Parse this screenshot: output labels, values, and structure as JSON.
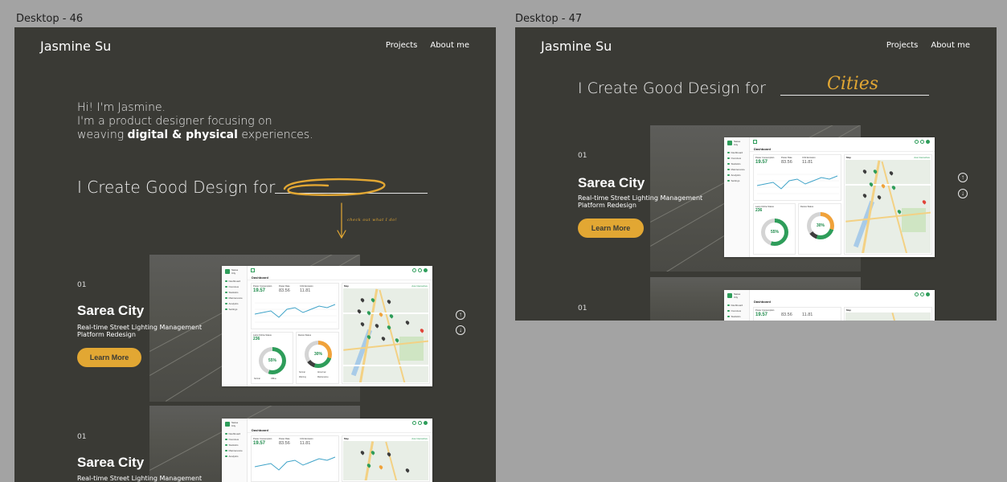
{
  "frames": [
    {
      "label": "Desktop - 46"
    },
    {
      "label": "Desktop - 47"
    }
  ],
  "site": {
    "brand": "Jasmine Su",
    "nav": [
      "Projects",
      "About me"
    ]
  },
  "intro": {
    "line1": "Hi! I'm Jasmine.",
    "line2": "I'm a product designer focusing on",
    "line3_pre": "weaving ",
    "line3_bold": "digital & physical",
    "line3_post": " experiences."
  },
  "headline": {
    "text": "I Create Good Design for",
    "script_word": "Cities",
    "hint": "check out what I do!"
  },
  "project": {
    "number": "01",
    "title": "Sarea City",
    "subtitle_line1": "Real-time Street Lighting Management",
    "subtitle_line2": "Platform Redesign",
    "cta": "Learn More"
  },
  "dashboard": {
    "logo_text_1": "Sarea",
    "logo_text_2": "City",
    "page_title": "Dashboard",
    "sidebar": [
      "Dashboard",
      "Overview",
      "Statistics",
      "Maintenance",
      "Analytics",
      "Settings"
    ],
    "power_label": "Power Consumption",
    "power_value": "19.57",
    "power_unit": "kWh",
    "metric2_label": "Power Rate",
    "metric2_value": "83.56",
    "metric2_unit": "kWh",
    "metric3_label": "CO2 Emission",
    "metric3_value": "11.81",
    "metric3_unit": "kg",
    "map_label": "Map",
    "map_link": "Ava Interactive",
    "light_label": "Lamp Online Status",
    "light_value": "236",
    "light_unit": "lamps",
    "device_label": "Device Status",
    "donut1_value": "55%",
    "donut2_value": "30%",
    "legend": [
      "Normal",
      "Offline",
      "Abnormal",
      "Warning",
      "Maintenance"
    ]
  },
  "colors": {
    "frame_bg": "#3a3a35",
    "canvas_bg": "#a3a3a3",
    "accent": "#e2a733",
    "brand_green": "#2e9d5a"
  }
}
